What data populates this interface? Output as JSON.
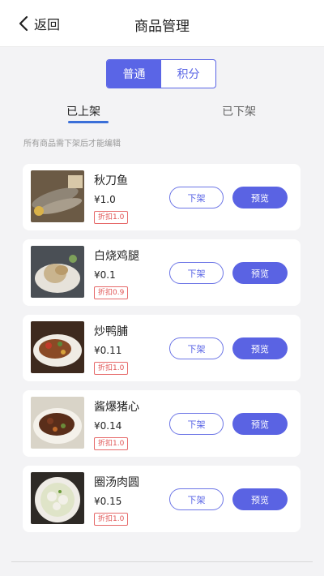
{
  "header": {
    "back_label": "返回",
    "title": "商品管理"
  },
  "segment": {
    "items": [
      "普通",
      "积分"
    ],
    "active": 0
  },
  "subtabs": {
    "listed": "已上架",
    "delisted": "已下架"
  },
  "hint": "所有商品需下架后才能编辑",
  "buttons": {
    "down": "下架",
    "preview": "预览"
  },
  "products": [
    {
      "name": "秋刀鱼",
      "price": "¥1.0",
      "discount": "折扣1.0"
    },
    {
      "name": "白烧鸡腿",
      "price": "¥0.1",
      "discount": "折扣0.9"
    },
    {
      "name": "炒鸭脯",
      "price": "¥0.11",
      "discount": "折扣1.0"
    },
    {
      "name": "酱爆猪心",
      "price": "¥0.14",
      "discount": "折扣1.0"
    },
    {
      "name": "圈汤肉圆",
      "price": "¥0.15",
      "discount": "折扣1.0"
    }
  ],
  "colors": {
    "accent": "#5a65e6",
    "discount": "#e05555",
    "background": "#f3f3f5"
  }
}
